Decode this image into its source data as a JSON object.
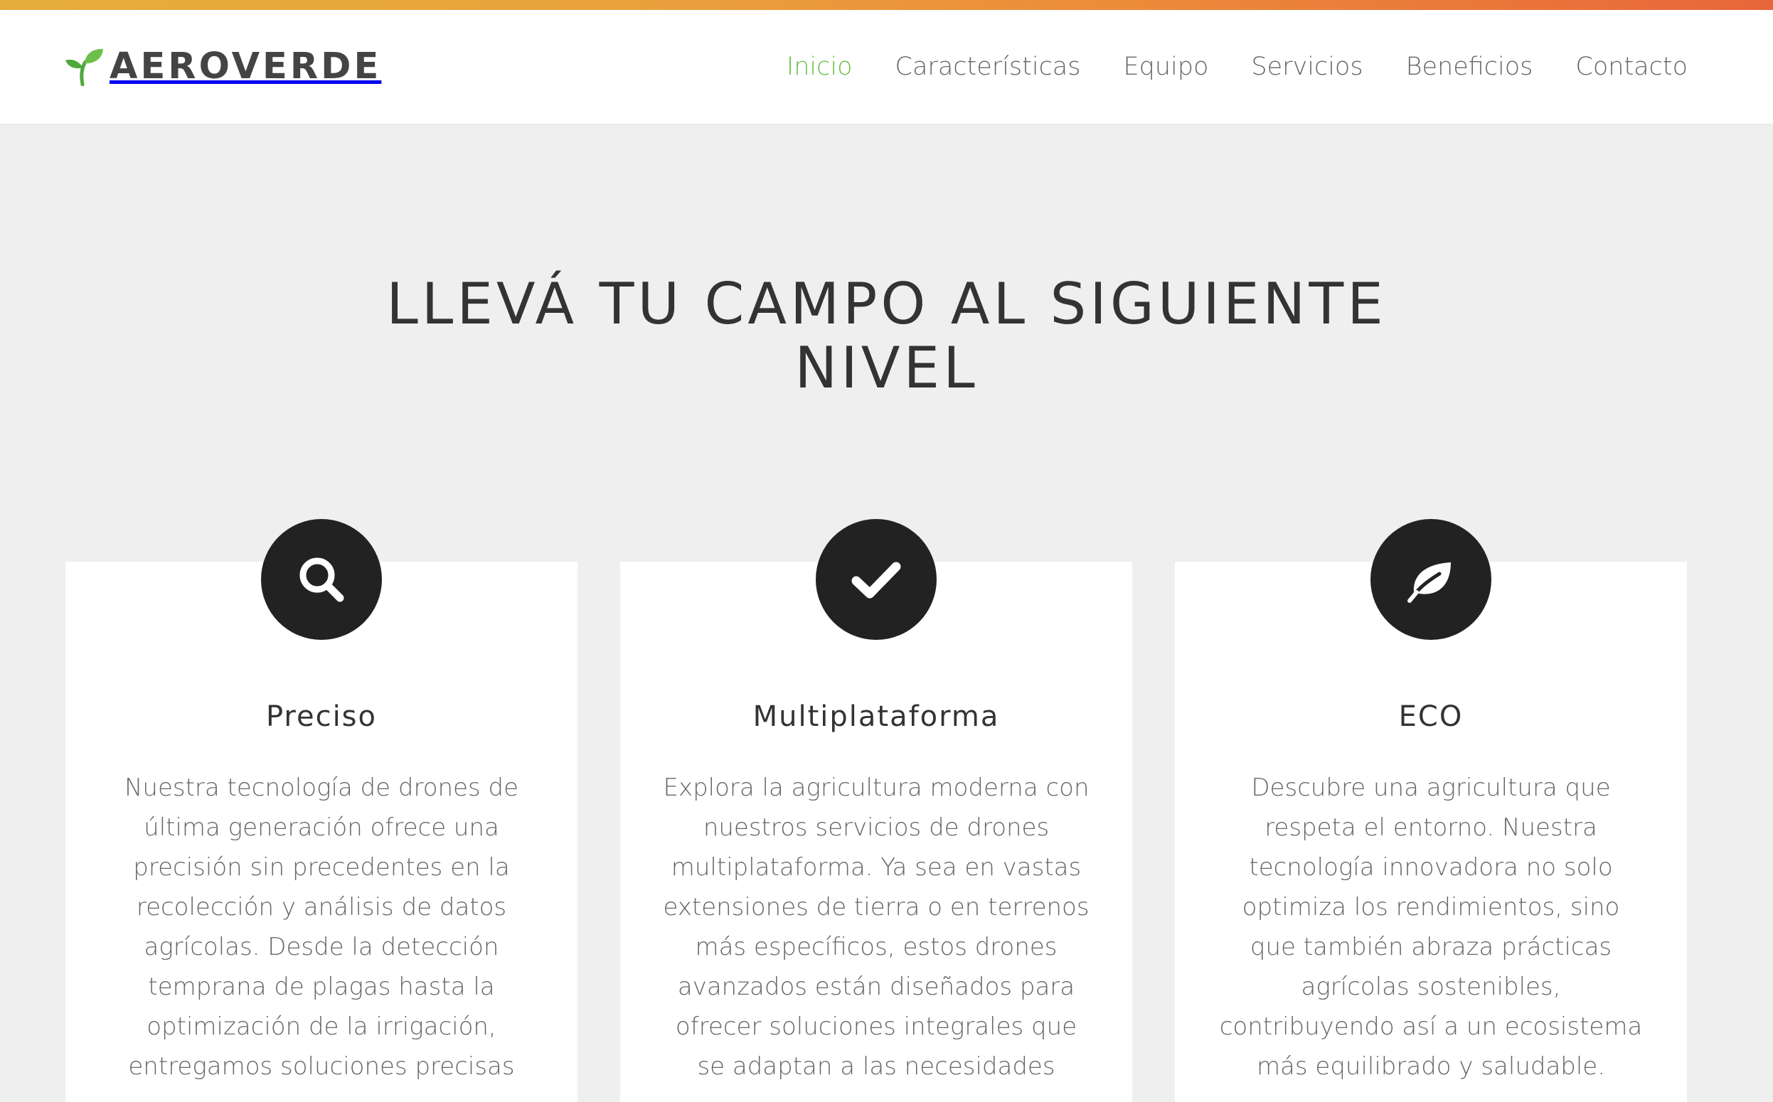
{
  "header": {
    "brand": "AEROVERDE",
    "logo_icon": "sprout-icon",
    "nav": [
      {
        "label": "Inicio",
        "active": true
      },
      {
        "label": "Características",
        "active": false
      },
      {
        "label": "Equipo",
        "active": false
      },
      {
        "label": "Servicios",
        "active": false
      },
      {
        "label": "Beneficios",
        "active": false
      },
      {
        "label": "Contacto",
        "active": false
      }
    ]
  },
  "hero": {
    "title_line1": "LLEVÁ TU CAMPO AL SIGUIENTE",
    "title_line2": "NIVEL"
  },
  "features": [
    {
      "icon": "search-icon",
      "title": "Preciso",
      "text": "Nuestra tecnología de drones de última generación ofrece una precisión sin precedentes en la recolección y análisis de datos agrícolas. Desde la detección temprana de plagas hasta la optimización de la irrigación, entregamos soluciones precisas"
    },
    {
      "icon": "check-icon",
      "title": "Multiplataforma",
      "text": "Explora la agricultura moderna con nuestros servicios de drones multiplataforma. Ya sea en vastas extensiones de tierra o en terrenos más específicos, estos drones avanzados están diseñados para ofrecer soluciones integrales que se adaptan a las necesidades"
    },
    {
      "icon": "leaf-icon",
      "title": "ECO",
      "text": "Descubre una agricultura que respeta el entorno. Nuestra tecnología innovadora no solo optimiza los rendimientos, sino que también abraza prácticas agrícolas sostenibles, contribuyendo así a un ecosistema más equilibrado y saludable."
    }
  ],
  "colors": {
    "accent": "#6cc04a",
    "dark": "#222222",
    "background": "#efefef",
    "strip_start": "#e5ae3a",
    "strip_end": "#e8663a"
  }
}
